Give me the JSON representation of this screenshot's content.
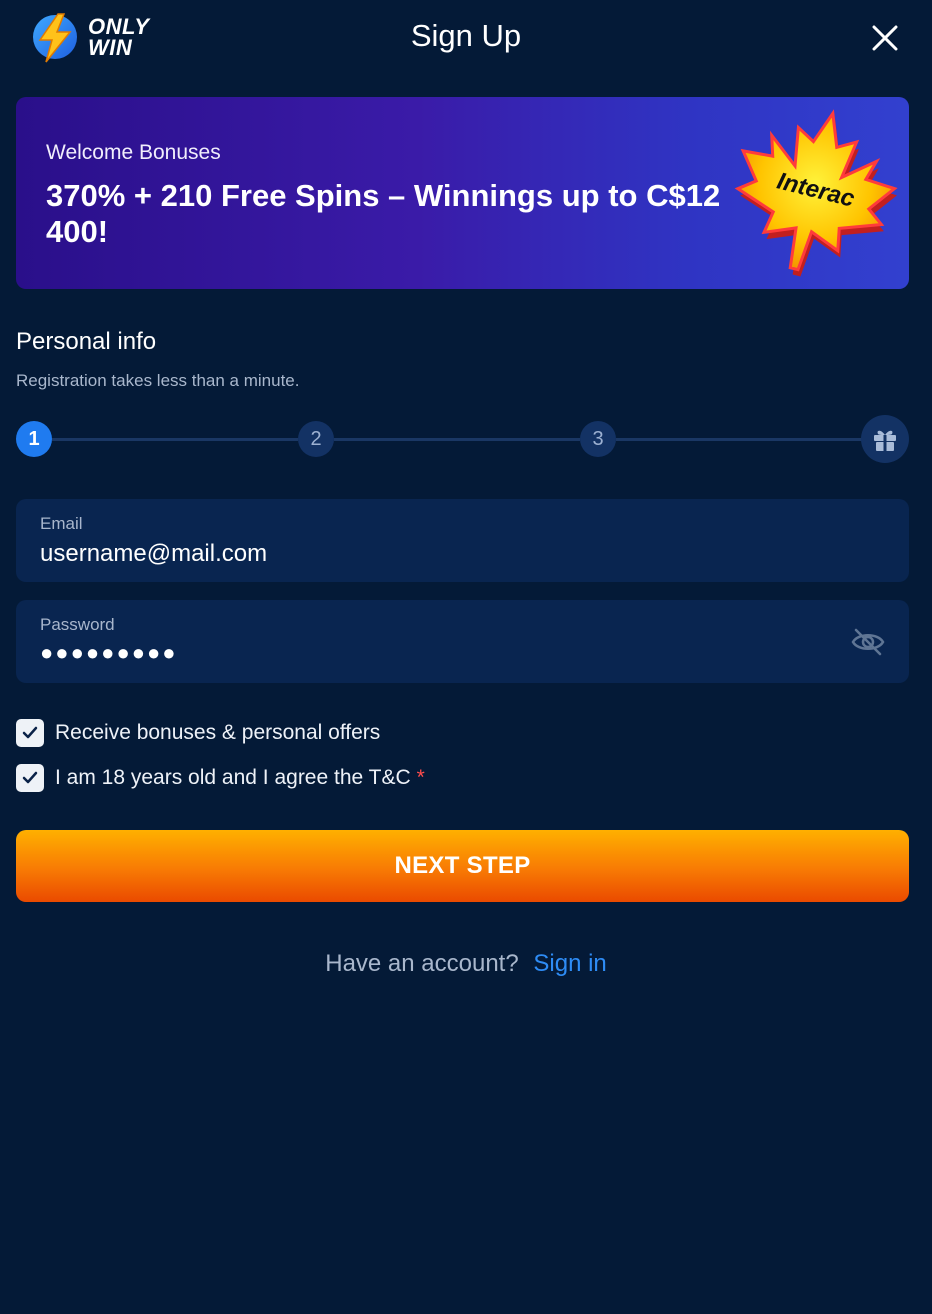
{
  "brand": {
    "logo_line1": "ONLY",
    "logo_line2": "WIN"
  },
  "header": {
    "title": "Sign Up",
    "close_icon": "close-icon"
  },
  "banner": {
    "subtitle": "Welcome Bonuses",
    "title": "370% + 210 Free Spins – Winnings up to C$12 400!",
    "image_icon": "interac-maple-leaf",
    "leaf_text": "Interac"
  },
  "personal_info": {
    "title": "Personal info",
    "subtitle": "Registration takes less than a minute."
  },
  "stepper": {
    "steps": [
      "1",
      "2",
      "3"
    ],
    "active_step": "1",
    "final_icon": "gift-icon"
  },
  "form": {
    "email": {
      "label": "Email",
      "value": "username@mail.com"
    },
    "password": {
      "label": "Password",
      "value": "●●●●●●●●●",
      "toggle_icon": "eye-off-icon"
    }
  },
  "checkboxes": [
    {
      "label": "Receive bonuses & personal offers",
      "checked": true,
      "required": false
    },
    {
      "label": "I am 18 years old and I agree the T&C",
      "checked": true,
      "required": true,
      "required_mark": "*"
    }
  ],
  "next_button": {
    "label": "NEXT STEP"
  },
  "footer": {
    "prompt": "Have an account?",
    "link": "Sign in"
  },
  "colors": {
    "background": "#041a37",
    "field": "#092550",
    "accent_blue": "#1f7bf0",
    "link": "#2e8cf5",
    "button_top": "#ffb000",
    "button_bottom": "#ea4a00",
    "required": "#ff4d4d"
  }
}
